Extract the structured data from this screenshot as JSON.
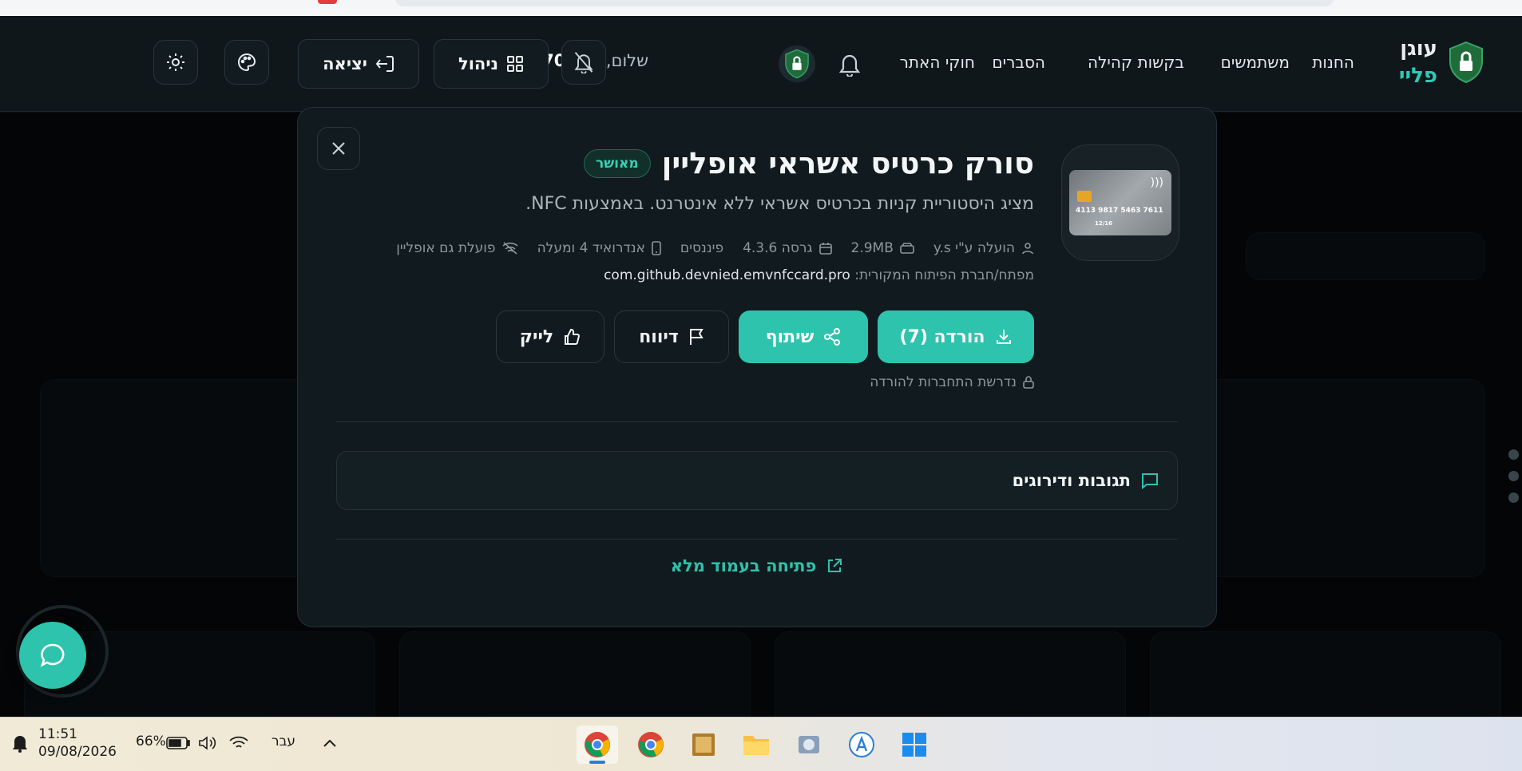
{
  "header": {
    "logo_line1": "עוגן",
    "logo_line2": "פליי",
    "nav": [
      "החנות",
      "משתמשים",
      "בקשות קהילה",
      "הסברים",
      "חוקי האתר"
    ],
    "greeting_prefix": "שלום,",
    "username": "e0556770172",
    "manage_label": "ניהול",
    "logout_label": "יציאה"
  },
  "modal": {
    "title": "סורק כרטיס אשראי אופליין",
    "status_badge": "מאושר",
    "description": "מציג היסטוריית קניות בכרטיס אשראי ללא אינטרנט. באמצעות NFC.",
    "card": {
      "number": "4113 9817 5463 7611",
      "expiry": "12/16"
    },
    "meta": {
      "uploader": "הועלה ע\"י y.s",
      "size": "2.9MB",
      "version": "גרסה 4.3.6",
      "category": "פיננסים",
      "android": "אנדרואיד 4 ומעלה",
      "offline": "פועלת גם אופליין"
    },
    "package_label": "מפתח/חברת הפיתוח המקורית:",
    "package_name": "com.github.devnied.emvnfccard.pro",
    "actions": {
      "download": "הורדה (7)",
      "share": "שיתוף",
      "report": "דיווח",
      "like": "לייק"
    },
    "login_required": "נדרשת התחברות להורדה",
    "comments_label": "תגובות ודירוגים",
    "open_full": "פתיחה בעמוד מלא"
  },
  "taskbar": {
    "time": "11:51",
    "date": "09/08/2026",
    "battery": "66%",
    "language": "עבר"
  },
  "colors": {
    "accent": "#2ec3ad",
    "background": "#111a1e",
    "badge": "#38d1b8"
  }
}
